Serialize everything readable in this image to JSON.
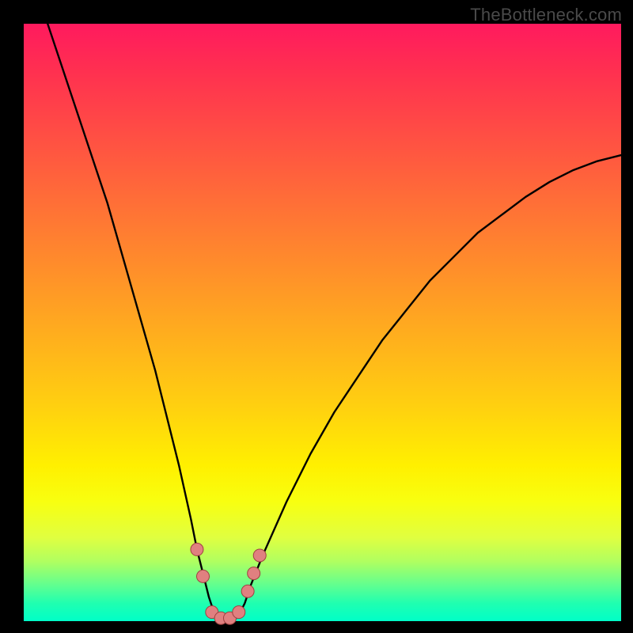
{
  "attribution": "TheBottleneck.com",
  "colors": {
    "curve": "#000000",
    "marker_fill": "#e08080",
    "marker_stroke": "#a04040",
    "gradient_top": "#ff1a5e",
    "gradient_bottom": "#00ffc8",
    "page_bg": "#000000"
  },
  "chart_data": {
    "type": "line",
    "title": "",
    "xlabel": "",
    "ylabel": "",
    "xlim": [
      0,
      100
    ],
    "ylim": [
      0,
      100
    ],
    "legend": false,
    "grid": false,
    "series": [
      {
        "name": "bottleneck-curve",
        "description": "V-shaped bottleneck curve; value drops to 0 near x≈31–36 then rises",
        "x": [
          4,
          6,
          8,
          10,
          12,
          14,
          16,
          18,
          20,
          22,
          24,
          26,
          28,
          29,
          30,
          31,
          32,
          33,
          34,
          35,
          36,
          37,
          38,
          40,
          44,
          48,
          52,
          56,
          60,
          64,
          68,
          72,
          76,
          80,
          84,
          88,
          92,
          96,
          100
        ],
        "values": [
          100,
          94,
          88,
          82,
          76,
          70,
          63,
          56,
          49,
          42,
          34,
          26,
          17,
          12,
          8,
          4,
          1,
          0,
          0,
          0,
          1,
          3,
          6,
          11,
          20,
          28,
          35,
          41,
          47,
          52,
          57,
          61,
          65,
          68,
          71,
          73.5,
          75.5,
          77,
          78
        ],
        "stroke_width": 2.4
      }
    ],
    "markers": [
      {
        "x": 29.0,
        "y": 12.0
      },
      {
        "x": 30.0,
        "y": 7.5
      },
      {
        "x": 31.5,
        "y": 1.5
      },
      {
        "x": 33.0,
        "y": 0.5
      },
      {
        "x": 34.5,
        "y": 0.5
      },
      {
        "x": 36.0,
        "y": 1.5
      },
      {
        "x": 37.5,
        "y": 5.0
      },
      {
        "x": 38.5,
        "y": 8.0
      },
      {
        "x": 39.5,
        "y": 11.0
      }
    ],
    "marker_radius": 8
  }
}
